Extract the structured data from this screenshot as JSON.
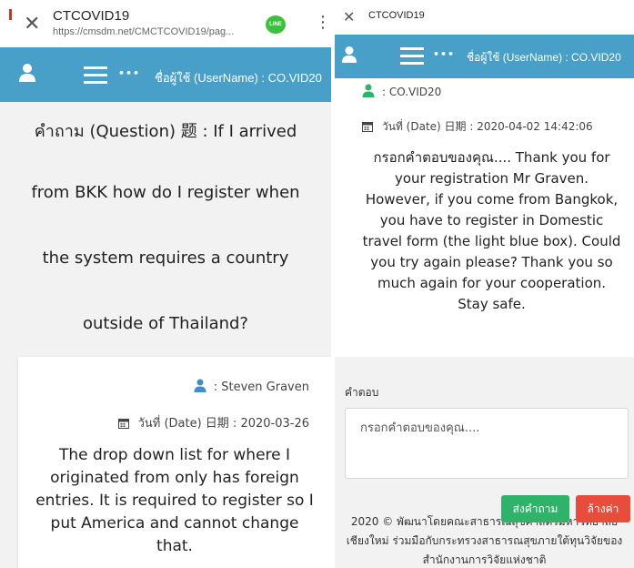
{
  "left": {
    "browser": {
      "title": "CTCOVID19",
      "url": "https://cmsdm.net/CMCTCOVID19/pag...",
      "line_badge": "LINE"
    },
    "navbar": {
      "menu_dots": "•••",
      "username": "ชื่อผู้ใช้ (UserName) : CO.VID20"
    },
    "question_lines": [
      "คำถาม (Question) 题 : If I arrived",
      "from BKK how do I register when",
      "the system requires a country",
      "outside of Thailand?"
    ],
    "post": {
      "author": ": Steven Graven",
      "date": "วันที่ (Date) 日期 : 2020-03-26",
      "body": "The drop down list for where I originated from only has foreign entries. It is required to register so I put America and cannot change that."
    }
  },
  "right": {
    "browser": {
      "title": "CTCOVID19"
    },
    "navbar": {
      "menu_dots": "•••",
      "username": "ชื่อผู้ใช้ (UserName) : CO.VID20"
    },
    "reply": {
      "author": ": CO.VID20",
      "date": "วันที่ (Date) 日期 : 2020-04-02 14:42:06",
      "body": "กรอกคำตอบของคุณ.... Thank you for your registration Mr Graven. However, if you come from Bangkok, you have to register in Domestic travel form (the light blue box). Could you try again please? Thank you so much again for your cooperation. Stay safe."
    },
    "answer_form": {
      "label": "คำตอบ",
      "placeholder": "กรอกคำตอบของคุณ....",
      "send_label": "ส่งคำถาม",
      "clear_label": "ล้างค่า"
    },
    "footer_lines": [
      "2020 © พัฒนาโดยคณะสาธารณสุขศาสตร์มหาวิทยาลัย",
      "เชียงใหม่ ร่วมมือกับกระทรวงสาธารณสุขภายใต้ทุนวิจัยของ",
      "สำนักงานการวิจัยแห่งชาติ"
    ]
  },
  "colors": {
    "navbar": "#48a0c8",
    "icon_blue": "#3d8fc6",
    "icon_green": "#2fb36b",
    "send_button": "#2fb36b",
    "clear_button": "#e74c3c"
  }
}
